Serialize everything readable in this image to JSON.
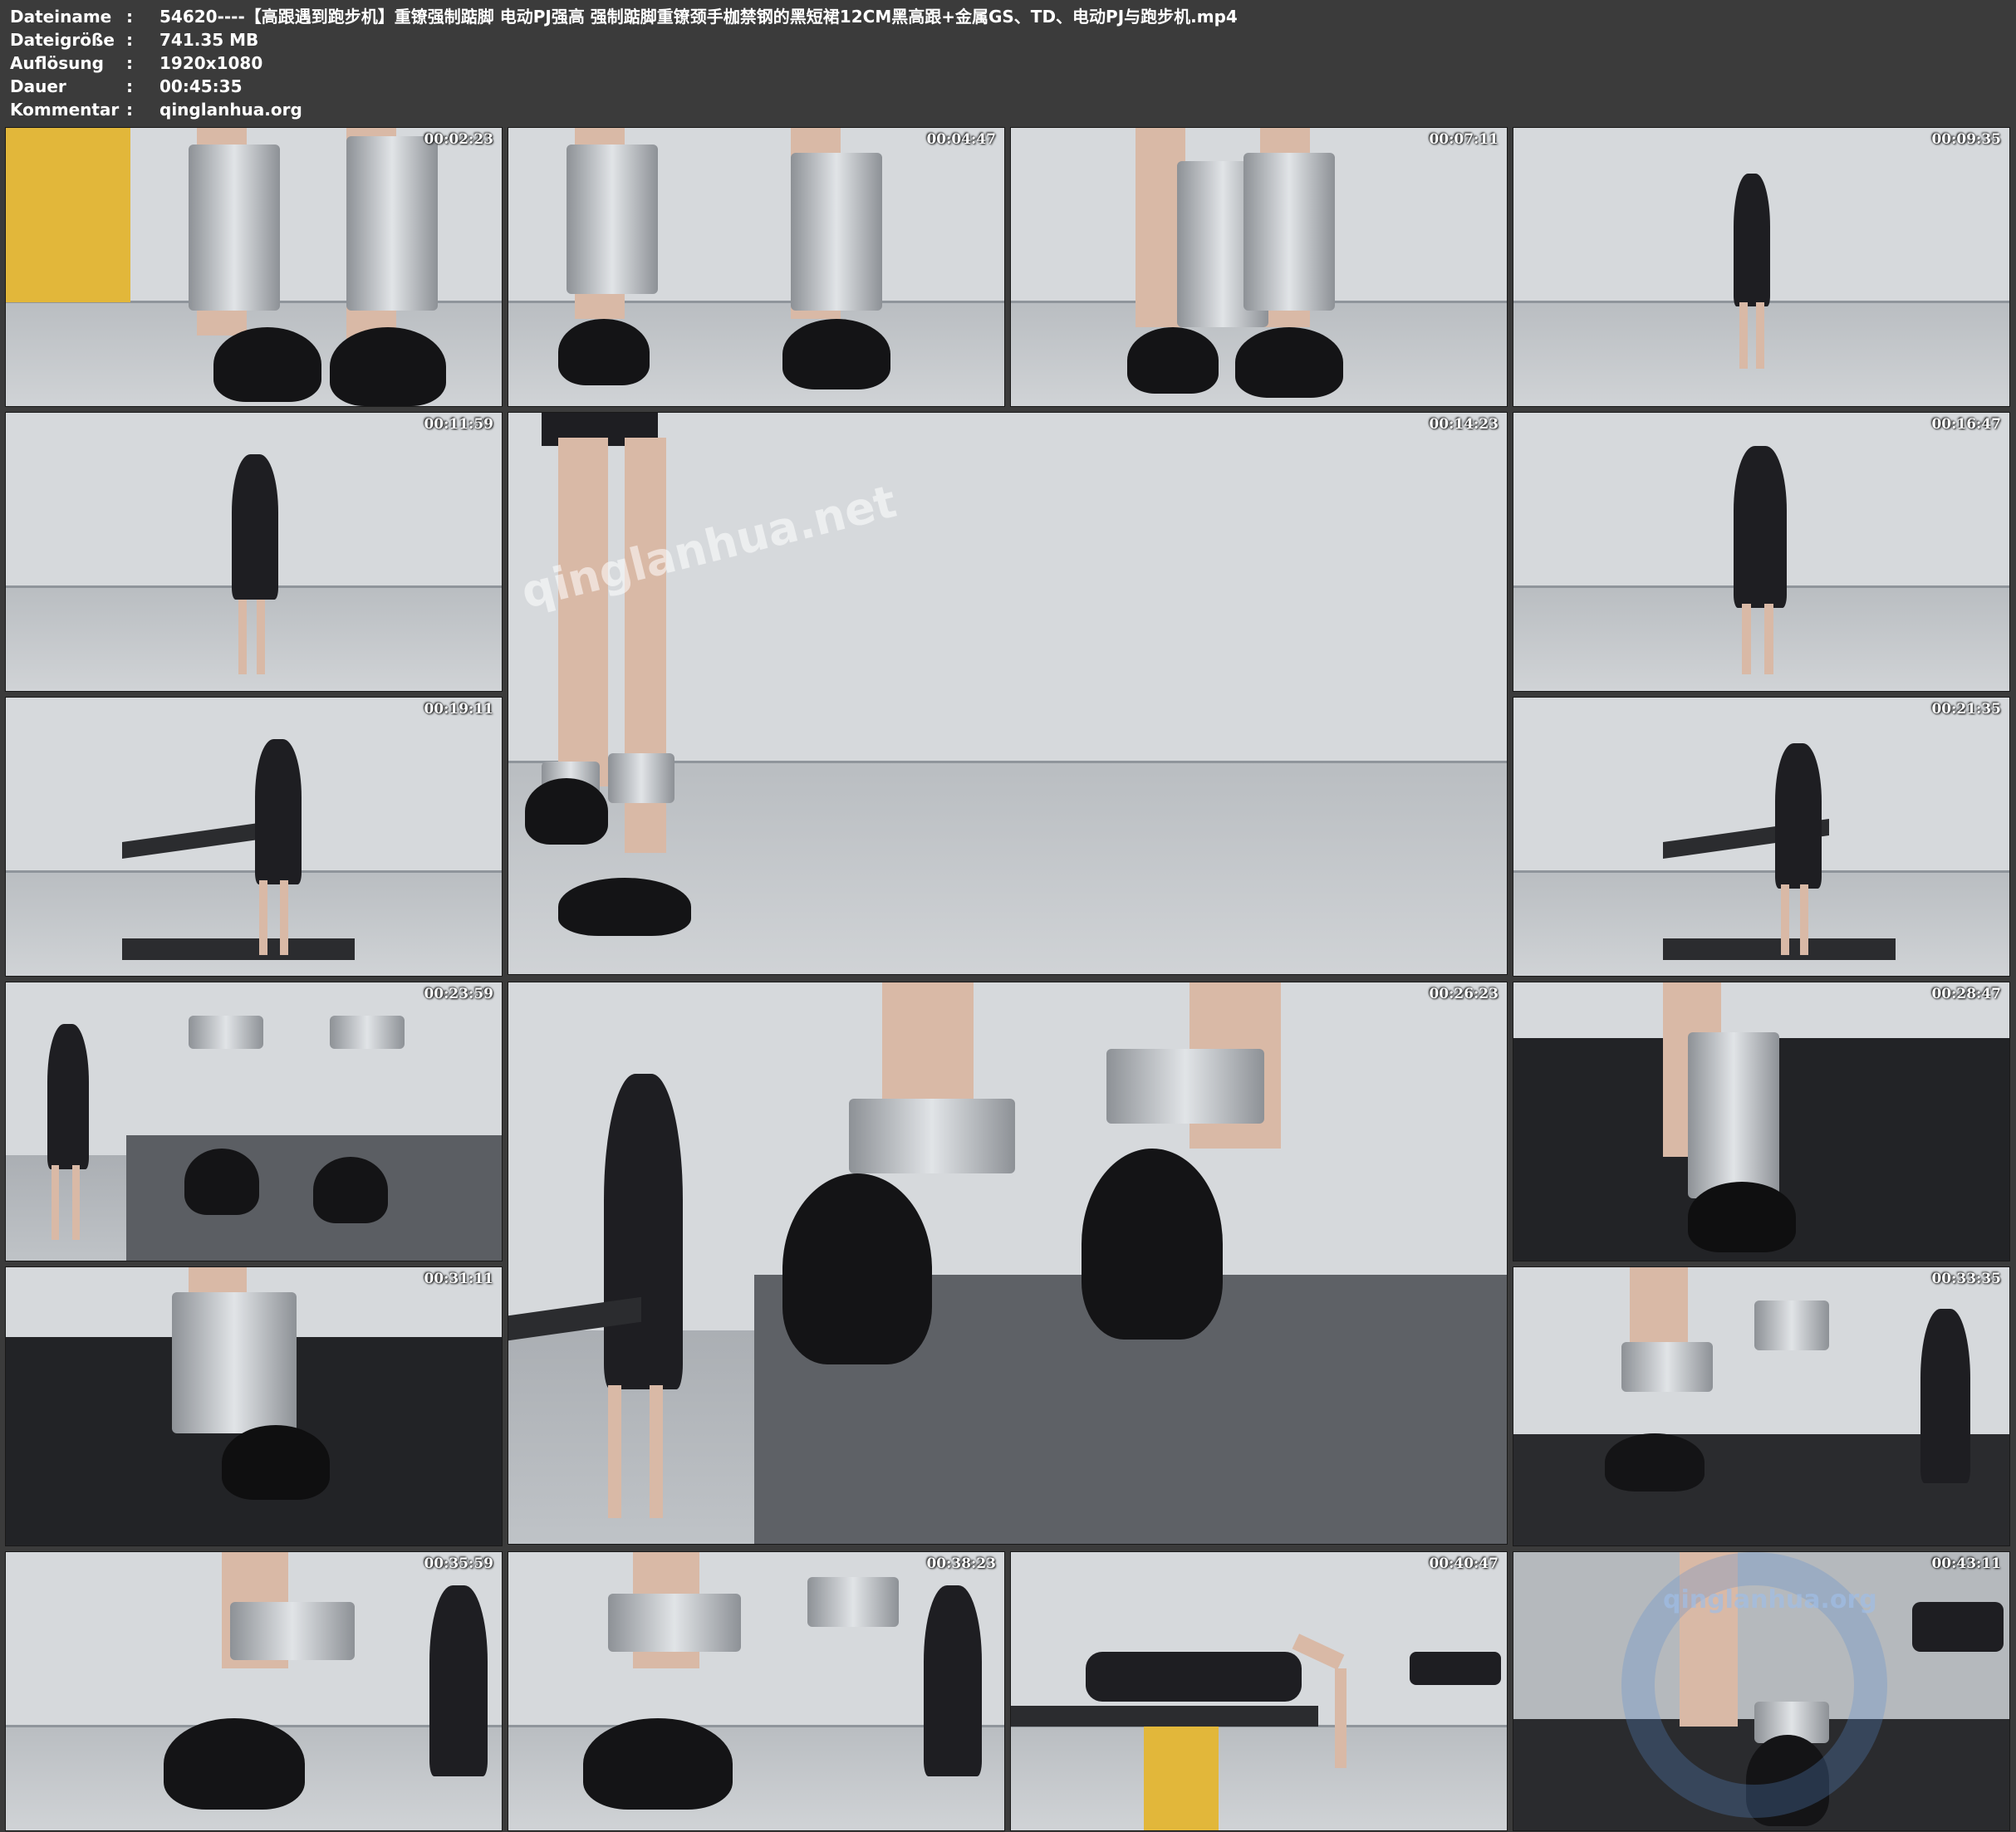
{
  "info": {
    "rows": [
      {
        "label": "Dateiname",
        "colon": ":",
        "value": "54620----【高跟遇到跑步机】重镣强制踮脚 电动PJ强高 强制踮脚重镣颈手枷禁钢的黑短裙12CM黑高跟+金属GS、TD、电动PJ与跑步机.mp4"
      },
      {
        "label": "Dateigröße",
        "colon": ":",
        "value": "741.35 MB"
      },
      {
        "label": "Auflösung",
        "colon": ":",
        "value": "1920x1080"
      },
      {
        "label": "Dauer",
        "colon": ":",
        "value": "00:45:35"
      },
      {
        "label": "Kommentar",
        "colon": ":",
        "value": "qinglanhua.org"
      }
    ]
  },
  "thumbnails": [
    {
      "timestamp": "00:02:23",
      "scene": "cuffs-closeup"
    },
    {
      "timestamp": "00:04:47",
      "scene": "cuffs-closeup"
    },
    {
      "timestamp": "00:07:11",
      "scene": "cuffs-closeup"
    },
    {
      "timestamp": "00:09:35",
      "scene": "standing-full"
    },
    {
      "timestamp": "00:11:59",
      "scene": "standing-full"
    },
    {
      "timestamp": "00:14:23",
      "scene": "legs-walking"
    },
    {
      "timestamp": "00:16:47",
      "scene": "standing-full"
    },
    {
      "timestamp": "00:19:11",
      "scene": "treadmill-full"
    },
    {
      "timestamp": "00:21:35",
      "scene": "treadmill-full"
    },
    {
      "timestamp": "00:23:59",
      "scene": "treadmill-split"
    },
    {
      "timestamp": "00:26:23",
      "scene": "treadmill-split-large"
    },
    {
      "timestamp": "00:28:47",
      "scene": "treadmill-cuff"
    },
    {
      "timestamp": "00:31:11",
      "scene": "treadmill-cuff"
    },
    {
      "timestamp": "00:33:35",
      "scene": "treadmill-cuff"
    },
    {
      "timestamp": "00:35:59",
      "scene": "cuffs-split"
    },
    {
      "timestamp": "00:38:23",
      "scene": "cuffs-split"
    },
    {
      "timestamp": "00:40:47",
      "scene": "lying-bench"
    },
    {
      "timestamp": "00:43:11",
      "scene": "machine"
    }
  ],
  "watermarks": {
    "center": "qinglanhua.net",
    "corner": "qinglanhua.org"
  },
  "colors": {
    "background": "#3b3b3b",
    "text": "#ffffff",
    "accent_yellow": "#e2b73a"
  }
}
